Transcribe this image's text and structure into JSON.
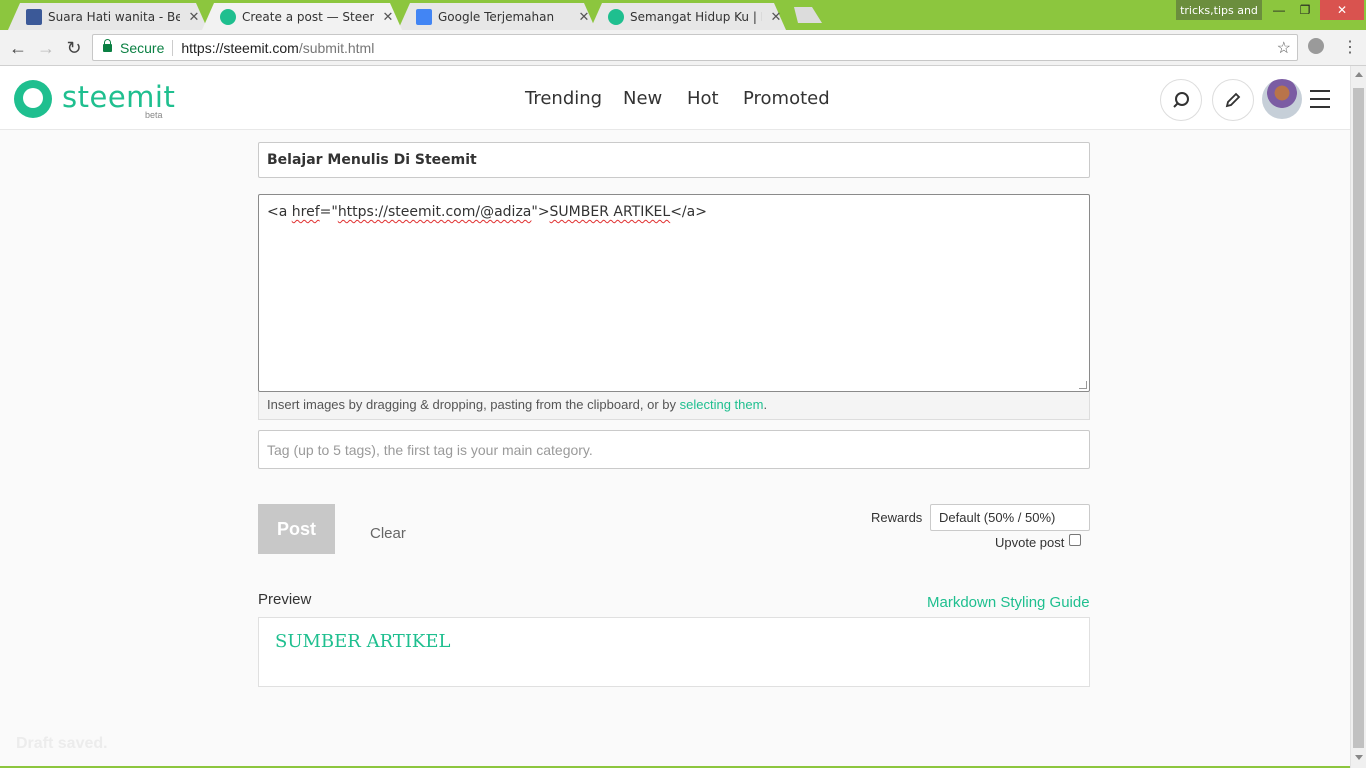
{
  "browser": {
    "tabs": [
      {
        "title": "Suara Hati wanita - Berand",
        "favicon": "facebook-icon",
        "favicon_color": "#3b5998",
        "active": false
      },
      {
        "title": "Create a post — Steemit",
        "favicon": "steemit-icon",
        "favicon_color": "#1fbf8f",
        "active": true
      },
      {
        "title": "Google Terjemahan",
        "favicon": "google-translate-icon",
        "favicon_color": "#4285f4",
        "active": false
      },
      {
        "title": "Semangat Hidup Ku | My",
        "favicon": "steemit-icon",
        "favicon_color": "#1fbf8f",
        "active": false
      }
    ],
    "profile_chip": "tricks,tips and",
    "secure_label": "Secure",
    "url_host": "https://steemit.com",
    "url_path": "/submit.html"
  },
  "header": {
    "logo_text": "steemit",
    "logo_badge": "beta",
    "nav": [
      "Trending",
      "New",
      "Hot",
      "Promoted"
    ]
  },
  "editor": {
    "title_value": "Belajar Menulis Di Steemit",
    "body_parts": {
      "p1": "<a ",
      "p2": "href",
      "p3": "=\"",
      "p4": "https://steemit.com/@adiza",
      "p5": "\">",
      "p6": "SUMBER ARTIKEL",
      "p7": "</a>"
    },
    "drop_hint": "Insert images by dragging & dropping, pasting from the clipboard, or by ",
    "drop_link": "selecting them",
    "drop_end": ".",
    "tag_placeholder": "Tag (up to 5 tags), the first tag is your main category.",
    "post_label": "Post",
    "clear_label": "Clear",
    "rewards_label": "Rewards",
    "rewards_value": "Default (50% / 50%)",
    "upvote_label": "Upvote post",
    "upvote_checked": false
  },
  "preview": {
    "label": "Preview",
    "guide_link": "Markdown Styling Guide",
    "content_link": "SUMBER ARTIKEL"
  },
  "status": {
    "draft": "Draft saved."
  },
  "colors": {
    "brand": "#1fbf8f",
    "titlebar": "#8cc63e"
  }
}
